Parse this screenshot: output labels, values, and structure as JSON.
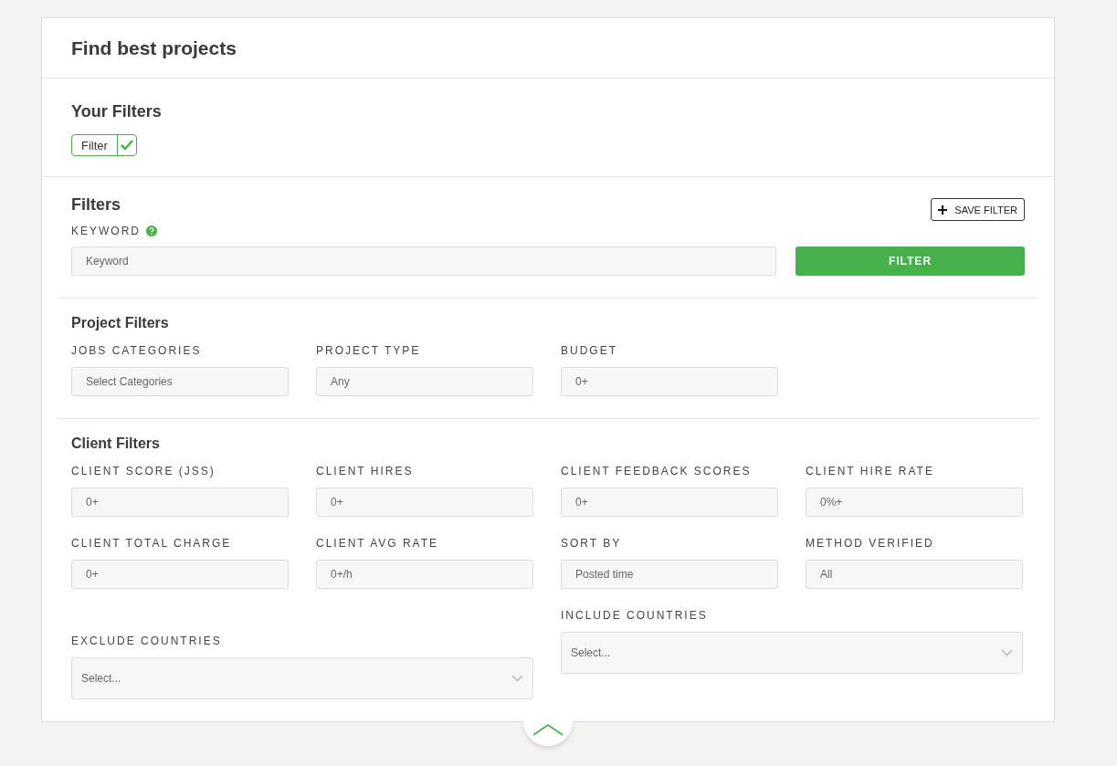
{
  "page": {
    "title": "Find best projects"
  },
  "your_filters": {
    "title": "Your Filters",
    "chips": [
      {
        "label": "Filter",
        "checked": true
      }
    ]
  },
  "filters": {
    "title": "Filters",
    "save_button": "SAVE FILTER",
    "keyword": {
      "label": "KEYWORD",
      "placeholder": "Keyword"
    },
    "filter_button": "FILTER"
  },
  "sections": [
    {
      "title": "Project Filters",
      "fields": [
        {
          "label": "JOBS CATEGORIES",
          "placeholder": "Select Categories",
          "kind": "input"
        },
        {
          "label": "PROJECT TYPE",
          "placeholder": "Any",
          "kind": "input"
        },
        {
          "label": "BUDGET",
          "placeholder": "0+",
          "kind": "input"
        }
      ]
    },
    {
      "title": "Client Filters",
      "fields": [
        {
          "label": "CLIENT SCORE (JSS)",
          "placeholder": "0+",
          "kind": "input"
        },
        {
          "label": "CLIENT HIRES",
          "placeholder": "0+",
          "kind": "input"
        },
        {
          "label": "CLIENT FEEDBACK SCORES",
          "placeholder": "0+",
          "kind": "input"
        },
        {
          "label": "CLIENT HIRE RATE",
          "placeholder": "0%+",
          "kind": "input"
        },
        {
          "label": "CLIENT TOTAL CHARGE",
          "placeholder": "0+",
          "kind": "input"
        },
        {
          "label": "CLIENT AVG RATE",
          "placeholder": "0+/h",
          "kind": "input"
        },
        {
          "label": "SORT BY",
          "placeholder": "Posted time",
          "kind": "input"
        },
        {
          "label": "METHOD VERIFIED",
          "placeholder": "All",
          "kind": "input"
        },
        {
          "label": "EXCLUDE COUNTRIES",
          "placeholder": "Select...",
          "kind": "select"
        },
        {
          "label": "INCLUDE COUNTRIES",
          "placeholder": "Select...",
          "kind": "select"
        }
      ]
    }
  ]
}
